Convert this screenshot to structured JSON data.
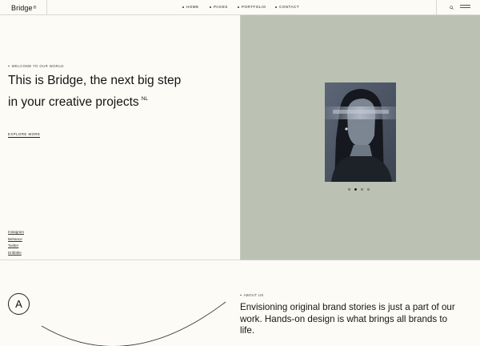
{
  "header": {
    "logo": "Bridge",
    "logo_mark": "®",
    "nav": [
      {
        "label": "HOME"
      },
      {
        "label": "PAGES"
      },
      {
        "label": "PORTFOLIO"
      },
      {
        "label": "CONTACT"
      }
    ],
    "search_icon": "search-icon",
    "menu_icon": "hamburger-icon"
  },
  "hero": {
    "eyebrow": "WELCOME TO OUR WORLD",
    "title": "This is Bridge, the next big step in your creative projects",
    "title_sup": "NL",
    "explore": "EXPLORE MORE",
    "social": [
      "Instagram",
      "Behance",
      "Twitter",
      "Dribbble"
    ],
    "slider": {
      "total": 4,
      "active_index": 1
    },
    "colors": {
      "panel": "#bcc2b3",
      "background": "#fcfbf6"
    }
  },
  "about": {
    "badge_letter": "A",
    "eyebrow": "ABOUT US",
    "text": "Envisioning original brand stories is just a part of our work. Hands-on design is what brings all brands to life."
  }
}
